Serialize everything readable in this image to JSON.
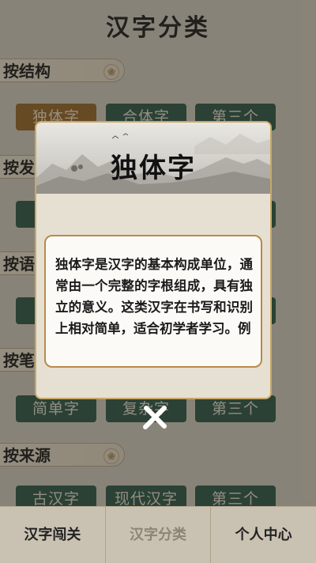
{
  "page": {
    "title": "汉字分类"
  },
  "sections": [
    {
      "label": "按结构",
      "options": [
        "独体字",
        "合体字",
        "第三个"
      ]
    },
    {
      "label": "按发",
      "options": [
        "",
        "",
        ""
      ]
    },
    {
      "label": "按语",
      "options": [
        "",
        "",
        ""
      ]
    },
    {
      "label": "按笔",
      "options": [
        "简单字",
        "复杂字",
        "第三个"
      ]
    },
    {
      "label": "按来源",
      "options": [
        "古汉字",
        "现代汉字",
        "第三个"
      ]
    }
  ],
  "dialog": {
    "title": "独体字",
    "body": "独体字是汉字的基本构成单位，通常由一个完整的字根组成，具有独立的意义。这类汉字在书写和识别上相对简单，适合初学者学习。例"
  },
  "bottom_nav": [
    {
      "label": "汉字闯关"
    },
    {
      "label": "汉字分类"
    },
    {
      "label": "个人中心"
    }
  ],
  "colors": {
    "accent_green": "#2f5a4a",
    "accent_brown": "#9a6a2a",
    "border_gold": "#c8a86a"
  }
}
